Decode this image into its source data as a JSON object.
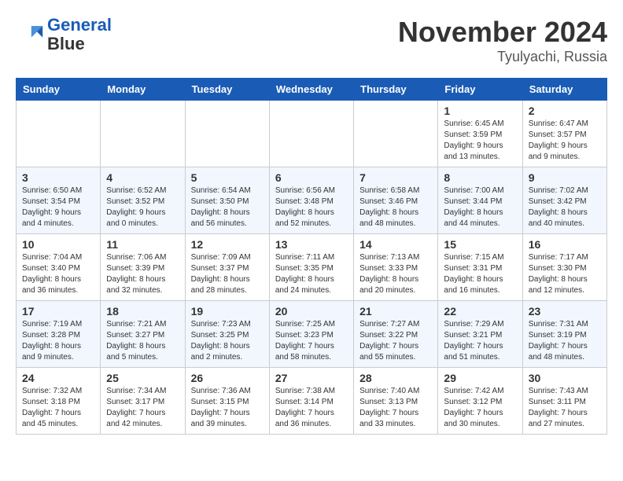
{
  "header": {
    "logo_line1": "General",
    "logo_line2": "Blue",
    "month_title": "November 2024",
    "location": "Tyulyachi, Russia"
  },
  "weekdays": [
    "Sunday",
    "Monday",
    "Tuesday",
    "Wednesday",
    "Thursday",
    "Friday",
    "Saturday"
  ],
  "weeks": [
    [
      {
        "day": "",
        "info": ""
      },
      {
        "day": "",
        "info": ""
      },
      {
        "day": "",
        "info": ""
      },
      {
        "day": "",
        "info": ""
      },
      {
        "day": "",
        "info": ""
      },
      {
        "day": "1",
        "info": "Sunrise: 6:45 AM\nSunset: 3:59 PM\nDaylight: 9 hours and 13 minutes."
      },
      {
        "day": "2",
        "info": "Sunrise: 6:47 AM\nSunset: 3:57 PM\nDaylight: 9 hours and 9 minutes."
      }
    ],
    [
      {
        "day": "3",
        "info": "Sunrise: 6:50 AM\nSunset: 3:54 PM\nDaylight: 9 hours and 4 minutes."
      },
      {
        "day": "4",
        "info": "Sunrise: 6:52 AM\nSunset: 3:52 PM\nDaylight: 9 hours and 0 minutes."
      },
      {
        "day": "5",
        "info": "Sunrise: 6:54 AM\nSunset: 3:50 PM\nDaylight: 8 hours and 56 minutes."
      },
      {
        "day": "6",
        "info": "Sunrise: 6:56 AM\nSunset: 3:48 PM\nDaylight: 8 hours and 52 minutes."
      },
      {
        "day": "7",
        "info": "Sunrise: 6:58 AM\nSunset: 3:46 PM\nDaylight: 8 hours and 48 minutes."
      },
      {
        "day": "8",
        "info": "Sunrise: 7:00 AM\nSunset: 3:44 PM\nDaylight: 8 hours and 44 minutes."
      },
      {
        "day": "9",
        "info": "Sunrise: 7:02 AM\nSunset: 3:42 PM\nDaylight: 8 hours and 40 minutes."
      }
    ],
    [
      {
        "day": "10",
        "info": "Sunrise: 7:04 AM\nSunset: 3:40 PM\nDaylight: 8 hours and 36 minutes."
      },
      {
        "day": "11",
        "info": "Sunrise: 7:06 AM\nSunset: 3:39 PM\nDaylight: 8 hours and 32 minutes."
      },
      {
        "day": "12",
        "info": "Sunrise: 7:09 AM\nSunset: 3:37 PM\nDaylight: 8 hours and 28 minutes."
      },
      {
        "day": "13",
        "info": "Sunrise: 7:11 AM\nSunset: 3:35 PM\nDaylight: 8 hours and 24 minutes."
      },
      {
        "day": "14",
        "info": "Sunrise: 7:13 AM\nSunset: 3:33 PM\nDaylight: 8 hours and 20 minutes."
      },
      {
        "day": "15",
        "info": "Sunrise: 7:15 AM\nSunset: 3:31 PM\nDaylight: 8 hours and 16 minutes."
      },
      {
        "day": "16",
        "info": "Sunrise: 7:17 AM\nSunset: 3:30 PM\nDaylight: 8 hours and 12 minutes."
      }
    ],
    [
      {
        "day": "17",
        "info": "Sunrise: 7:19 AM\nSunset: 3:28 PM\nDaylight: 8 hours and 9 minutes."
      },
      {
        "day": "18",
        "info": "Sunrise: 7:21 AM\nSunset: 3:27 PM\nDaylight: 8 hours and 5 minutes."
      },
      {
        "day": "19",
        "info": "Sunrise: 7:23 AM\nSunset: 3:25 PM\nDaylight: 8 hours and 2 minutes."
      },
      {
        "day": "20",
        "info": "Sunrise: 7:25 AM\nSunset: 3:23 PM\nDaylight: 7 hours and 58 minutes."
      },
      {
        "day": "21",
        "info": "Sunrise: 7:27 AM\nSunset: 3:22 PM\nDaylight: 7 hours and 55 minutes."
      },
      {
        "day": "22",
        "info": "Sunrise: 7:29 AM\nSunset: 3:21 PM\nDaylight: 7 hours and 51 minutes."
      },
      {
        "day": "23",
        "info": "Sunrise: 7:31 AM\nSunset: 3:19 PM\nDaylight: 7 hours and 48 minutes."
      }
    ],
    [
      {
        "day": "24",
        "info": "Sunrise: 7:32 AM\nSunset: 3:18 PM\nDaylight: 7 hours and 45 minutes."
      },
      {
        "day": "25",
        "info": "Sunrise: 7:34 AM\nSunset: 3:17 PM\nDaylight: 7 hours and 42 minutes."
      },
      {
        "day": "26",
        "info": "Sunrise: 7:36 AM\nSunset: 3:15 PM\nDaylight: 7 hours and 39 minutes."
      },
      {
        "day": "27",
        "info": "Sunrise: 7:38 AM\nSunset: 3:14 PM\nDaylight: 7 hours and 36 minutes."
      },
      {
        "day": "28",
        "info": "Sunrise: 7:40 AM\nSunset: 3:13 PM\nDaylight: 7 hours and 33 minutes."
      },
      {
        "day": "29",
        "info": "Sunrise: 7:42 AM\nSunset: 3:12 PM\nDaylight: 7 hours and 30 minutes."
      },
      {
        "day": "30",
        "info": "Sunrise: 7:43 AM\nSunset: 3:11 PM\nDaylight: 7 hours and 27 minutes."
      }
    ]
  ]
}
